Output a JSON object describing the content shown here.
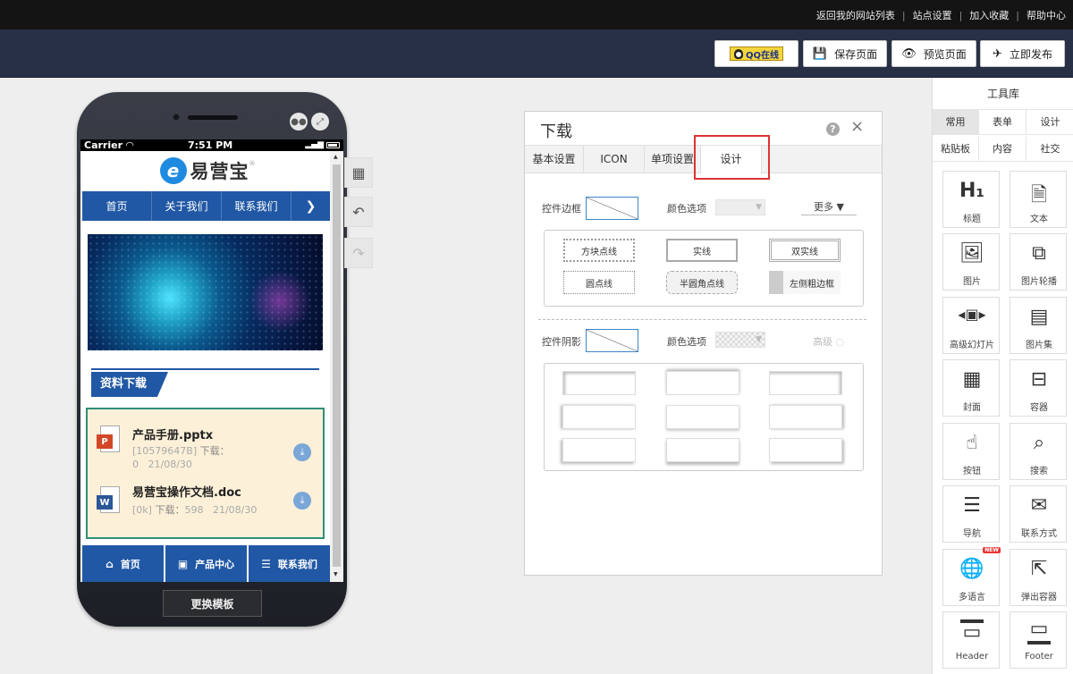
{
  "topbar": {
    "links": [
      "返回我的网站列表",
      "站点设置",
      "加入收藏",
      "帮助中心"
    ],
    "seps": [
      "|",
      "|",
      "|"
    ]
  },
  "toolbar": {
    "qq_label": "QQ在线",
    "save_label": "保存页面",
    "preview_label": "预览页面",
    "publish_label": "立即发布"
  },
  "phone": {
    "status": {
      "carrier": "Carrier",
      "time": "7:51 PM"
    },
    "logo_mark": "e",
    "logo_text": "易营宝",
    "logo_reg": "®",
    "menu": [
      "首页",
      "关于我们",
      "联系我们"
    ],
    "section_title": "资料下载",
    "downloads": [
      {
        "name": "产品手册.pptx",
        "size": "[10579647B]",
        "label": "下载：",
        "count": "0",
        "date": "21/08/30",
        "badge": "P"
      },
      {
        "name": "易营宝操作文档.doc",
        "size": "[0k]",
        "label": "下载：",
        "count": "598",
        "date": "21/08/30",
        "badge": "W"
      }
    ],
    "footer": [
      {
        "icon": "⌂",
        "label": "首页"
      },
      {
        "icon": "▣",
        "label": "产品中心"
      },
      {
        "icon": "☰",
        "label": "联系我们"
      }
    ],
    "switch_template": "更换模板"
  },
  "panel": {
    "title": "下载",
    "help": "?",
    "close": "×",
    "tabs": [
      "基本设置",
      "ICON",
      "单项设置",
      "设计"
    ],
    "border_label": "控件边框",
    "color_label": "颜色选项",
    "more_label": "更多 ▼",
    "border_options": [
      "方块点线",
      "实线",
      "双实线",
      "圆点线",
      "半圆角点线",
      "左侧粗边框"
    ],
    "shadow_label": "控件阴影",
    "shadow_color_label": "颜色选项",
    "advanced_label": "高级"
  },
  "library": {
    "title": "工具库",
    "tabs": [
      "常用",
      "表单",
      "设计",
      "粘贴板",
      "内容",
      "社交"
    ],
    "widgets": [
      {
        "icon": "H₁",
        "label": "标题"
      },
      {
        "icon": "🗎",
        "label": "文本"
      },
      {
        "icon": "🖼",
        "label": "图片"
      },
      {
        "icon": "⧉",
        "label": "图片轮播"
      },
      {
        "icon": "◂▣▸",
        "label": "高级幻灯片"
      },
      {
        "icon": "▤",
        "label": "图片集"
      },
      {
        "icon": "▦",
        "label": "封面"
      },
      {
        "icon": "⊟",
        "label": "容器"
      },
      {
        "icon": "☝",
        "label": "按钮"
      },
      {
        "icon": "⌕",
        "label": "搜索"
      },
      {
        "icon": "☰",
        "label": "导航"
      },
      {
        "icon": "✉",
        "label": "联系方式"
      },
      {
        "icon": "🌐",
        "label": "多语言",
        "badge": "NEW"
      },
      {
        "icon": "⇱",
        "label": "弹出容器"
      },
      {
        "icon": "▭",
        "label": "Header"
      },
      {
        "icon": "▭",
        "label": "Footer"
      }
    ]
  },
  "colors": {
    "brand_blue": "#2158a5",
    "nav_bg": "#283046",
    "topbar_bg": "#141414",
    "highlight_red": "#dd3333",
    "download_bg": "#fcf0d8"
  }
}
